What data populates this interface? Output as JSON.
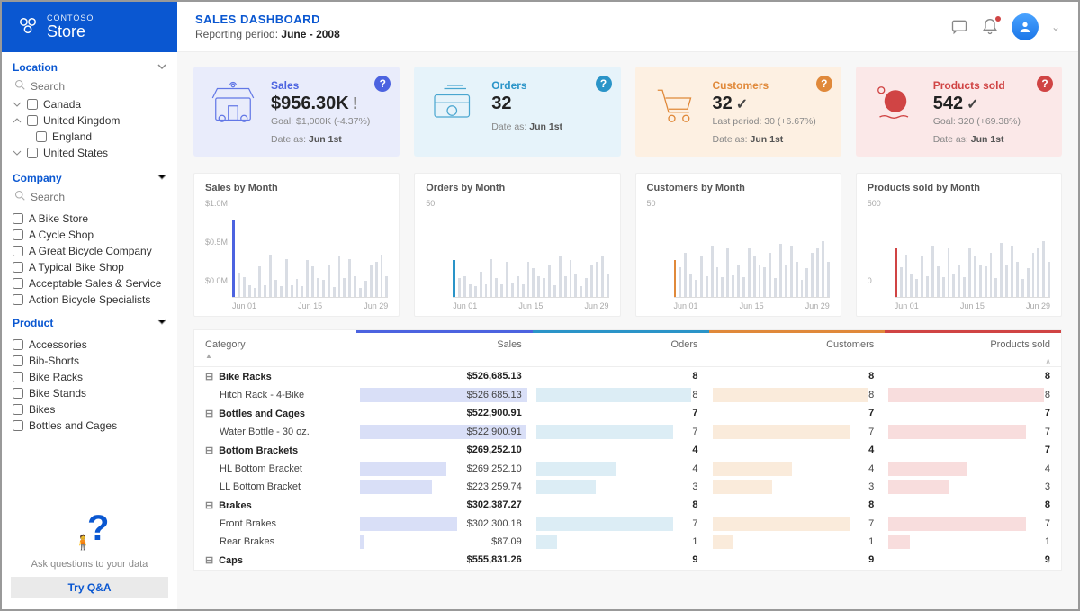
{
  "brand": {
    "company": "CONTOSO",
    "name": "Store"
  },
  "header": {
    "title": "SALES DASHBOARD",
    "period_label": "Reporting period: ",
    "period_value": "June - 2008"
  },
  "filters": {
    "location": {
      "title": "Location",
      "search_placeholder": "Search",
      "items": [
        {
          "label": "Canada"
        },
        {
          "label": "United Kingdom",
          "expanded": true,
          "children": [
            "England"
          ]
        },
        {
          "label": "United States"
        }
      ]
    },
    "company": {
      "title": "Company",
      "search_placeholder": "Search",
      "items": [
        "A Bike Store",
        "A Cycle Shop",
        "A Great Bicycle Company",
        "A Typical Bike Shop",
        "Acceptable Sales & Service",
        "Action Bicycle Specialists"
      ]
    },
    "product": {
      "title": "Product",
      "items": [
        "Accessories",
        "Bib-Shorts",
        "Bike Racks",
        "Bike Stands",
        "Bikes",
        "Bottles and Cages"
      ]
    }
  },
  "qa": {
    "ask": "Ask questions to your data",
    "try": "Try Q&A"
  },
  "kpis": {
    "sales": {
      "label": "Sales",
      "value": "$956.30K",
      "sub": "Goal: $1,000K (-4.37%)",
      "date_label": "Date as: ",
      "date": "Jun 1st",
      "status": "warn"
    },
    "orders": {
      "label": "Orders",
      "value": "32",
      "sub": "",
      "date_label": "Date as: ",
      "date": "Jun 1st"
    },
    "customers": {
      "label": "Customers",
      "value": "32",
      "sub": "Last period: 30 (+6.67%)",
      "date_label": "Date as: ",
      "date": "Jun 1st",
      "status": "ok"
    },
    "products": {
      "label": "Products sold",
      "value": "542",
      "sub": "Goal: 320 (+69.38%)",
      "date_label": "Date as: ",
      "date": "Jun 1st",
      "status": "ok"
    }
  },
  "charts": {
    "sales": {
      "title": "Sales by Month",
      "yticks": [
        "$1.0M",
        "$0.5M",
        "$0.0M"
      ],
      "xticks": [
        "Jun 01",
        "Jun 15",
        "Jun 29"
      ],
      "accent": "#4c63e0"
    },
    "orders": {
      "title": "Orders by Month",
      "yticks": [
        "50",
        ""
      ],
      "xticks": [
        "Jun 01",
        "Jun 15",
        "Jun 29"
      ],
      "accent": "#2a94c8"
    },
    "customers": {
      "title": "Customers by Month",
      "yticks": [
        "50",
        ""
      ],
      "xticks": [
        "Jun 01",
        "Jun 15",
        "Jun 29"
      ],
      "accent": "#e0893a"
    },
    "products": {
      "title": "Products sold by Month",
      "yticks": [
        "500",
        "0"
      ],
      "xticks": [
        "Jun 01",
        "Jun 15",
        "Jun 29"
      ],
      "accent": "#d04444"
    }
  },
  "chart_data": [
    {
      "type": "bar",
      "title": "Sales by Month",
      "xlabel": "",
      "ylabel": "",
      "ylim": [
        0,
        1000000
      ],
      "categories": [
        "Jun 01",
        "Jun 02",
        "Jun 03",
        "Jun 04",
        "Jun 05",
        "Jun 06",
        "Jun 07",
        "Jun 08",
        "Jun 09",
        "Jun 10",
        "Jun 11",
        "Jun 12",
        "Jun 13",
        "Jun 14",
        "Jun 15",
        "Jun 16",
        "Jun 17",
        "Jun 18",
        "Jun 19",
        "Jun 20",
        "Jun 21",
        "Jun 22",
        "Jun 23",
        "Jun 24",
        "Jun 25",
        "Jun 26",
        "Jun 27",
        "Jun 28",
        "Jun 29",
        "Jun 30"
      ],
      "values": [
        956000,
        300000,
        240000,
        140000,
        110000,
        380000,
        150000,
        520000,
        210000,
        130000,
        470000,
        150000,
        220000,
        130000,
        460000,
        380000,
        230000,
        210000,
        390000,
        120000,
        510000,
        230000,
        470000,
        260000,
        110000,
        200000,
        400000,
        430000,
        520000,
        260000
      ]
    },
    {
      "type": "bar",
      "title": "Orders by Month",
      "xlabel": "",
      "ylabel": "",
      "ylim": [
        0,
        70
      ],
      "categories": [
        "Jun 01",
        "Jun 02",
        "Jun 03",
        "Jun 04",
        "Jun 05",
        "Jun 06",
        "Jun 07",
        "Jun 08",
        "Jun 09",
        "Jun 10",
        "Jun 11",
        "Jun 12",
        "Jun 13",
        "Jun 14",
        "Jun 15",
        "Jun 16",
        "Jun 17",
        "Jun 18",
        "Jun 19",
        "Jun 20",
        "Jun 21",
        "Jun 22",
        "Jun 23",
        "Jun 24",
        "Jun 25",
        "Jun 26",
        "Jun 27",
        "Jun 28",
        "Jun 29",
        "Jun 30"
      ],
      "values": [
        32,
        16,
        18,
        11,
        9,
        22,
        11,
        33,
        16,
        11,
        30,
        12,
        18,
        11,
        30,
        25,
        18,
        16,
        27,
        10,
        35,
        18,
        32,
        20,
        9,
        16,
        27,
        30,
        36,
        20
      ]
    },
    {
      "type": "bar",
      "title": "Customers by Month",
      "xlabel": "",
      "ylabel": "",
      "ylim": [
        0,
        70
      ],
      "categories": [
        "Jun 01",
        "Jun 02",
        "Jun 03",
        "Jun 04",
        "Jun 05",
        "Jun 06",
        "Jun 07",
        "Jun 08",
        "Jun 09",
        "Jun 10",
        "Jun 11",
        "Jun 12",
        "Jun 13",
        "Jun 14",
        "Jun 15",
        "Jun 16",
        "Jun 17",
        "Jun 18",
        "Jun 19",
        "Jun 20",
        "Jun 21",
        "Jun 22",
        "Jun 23",
        "Jun 24",
        "Jun 25",
        "Jun 26",
        "Jun 27",
        "Jun 28",
        "Jun 29",
        "Jun 30"
      ],
      "values": [
        32,
        26,
        38,
        20,
        15,
        35,
        18,
        44,
        26,
        17,
        42,
        19,
        28,
        17,
        42,
        36,
        28,
        26,
        38,
        16,
        46,
        28,
        44,
        30,
        15,
        25,
        38,
        42,
        48,
        30
      ]
    },
    {
      "type": "bar",
      "title": "Products sold by Month",
      "xlabel": "",
      "ylabel": "",
      "ylim": [
        0,
        900
      ],
      "categories": [
        "Jun 01",
        "Jun 02",
        "Jun 03",
        "Jun 04",
        "Jun 05",
        "Jun 06",
        "Jun 07",
        "Jun 08",
        "Jun 09",
        "Jun 10",
        "Jun 11",
        "Jun 12",
        "Jun 13",
        "Jun 14",
        "Jun 15",
        "Jun 16",
        "Jun 17",
        "Jun 18",
        "Jun 19",
        "Jun 20",
        "Jun 21",
        "Jun 22",
        "Jun 23",
        "Jun 24",
        "Jun 25",
        "Jun 26",
        "Jun 27",
        "Jun 28",
        "Jun 29",
        "Jun 30"
      ],
      "values": [
        542,
        330,
        470,
        260,
        200,
        450,
        230,
        570,
        340,
        220,
        540,
        250,
        360,
        220,
        540,
        460,
        360,
        340,
        490,
        210,
        600,
        360,
        570,
        390,
        200,
        320,
        490,
        540,
        620,
        390
      ]
    }
  ],
  "table": {
    "headers": {
      "category": "Category",
      "sales": "Sales",
      "orders": "Oders",
      "customers": "Customers",
      "products": "Products sold"
    },
    "rows": [
      {
        "type": "cat",
        "name": "Bike Racks",
        "sales": "$526,685.13",
        "orders": "8",
        "customers": "8",
        "products": "8"
      },
      {
        "type": "item",
        "name": "Hitch Rack - 4-Bike",
        "sales": "$526,685.13",
        "orders": "8",
        "customers": "8",
        "products": "8",
        "sb": 95,
        "ob": 88,
        "cb": 88,
        "pb": 88
      },
      {
        "type": "cat",
        "name": "Bottles and Cages",
        "sales": "$522,900.91",
        "orders": "7",
        "customers": "7",
        "products": "7"
      },
      {
        "type": "item",
        "name": "Water Bottle - 30 oz.",
        "sales": "$522,900.91",
        "orders": "7",
        "customers": "7",
        "products": "7",
        "sb": 94,
        "ob": 78,
        "cb": 78,
        "pb": 78
      },
      {
        "type": "cat",
        "name": "Bottom Brackets",
        "sales": "$269,252.10",
        "orders": "4",
        "customers": "4",
        "products": "7"
      },
      {
        "type": "item",
        "name": "HL Bottom Bracket",
        "sales": "$269,252.10",
        "orders": "4",
        "customers": "4",
        "products": "4",
        "sb": 49,
        "ob": 45,
        "cb": 45,
        "pb": 45
      },
      {
        "type": "item",
        "name": "LL Bottom Bracket",
        "sales": "$223,259.74",
        "orders": "3",
        "customers": "3",
        "products": "3",
        "sb": 41,
        "ob": 34,
        "cb": 34,
        "pb": 34
      },
      {
        "type": "cat",
        "name": "Brakes",
        "sales": "$302,387.27",
        "orders": "8",
        "customers": "8",
        "products": "8"
      },
      {
        "type": "item",
        "name": "Front Brakes",
        "sales": "$302,300.18",
        "orders": "7",
        "customers": "7",
        "products": "7",
        "sb": 55,
        "ob": 78,
        "cb": 78,
        "pb": 78
      },
      {
        "type": "item",
        "name": "Rear Brakes",
        "sales": "$87.09",
        "orders": "1",
        "customers": "1",
        "products": "1",
        "sb": 2,
        "ob": 12,
        "cb": 12,
        "pb": 12
      },
      {
        "type": "cat",
        "name": "Caps",
        "sales": "$555,831.26",
        "orders": "9",
        "customers": "9",
        "products": "9"
      }
    ]
  }
}
